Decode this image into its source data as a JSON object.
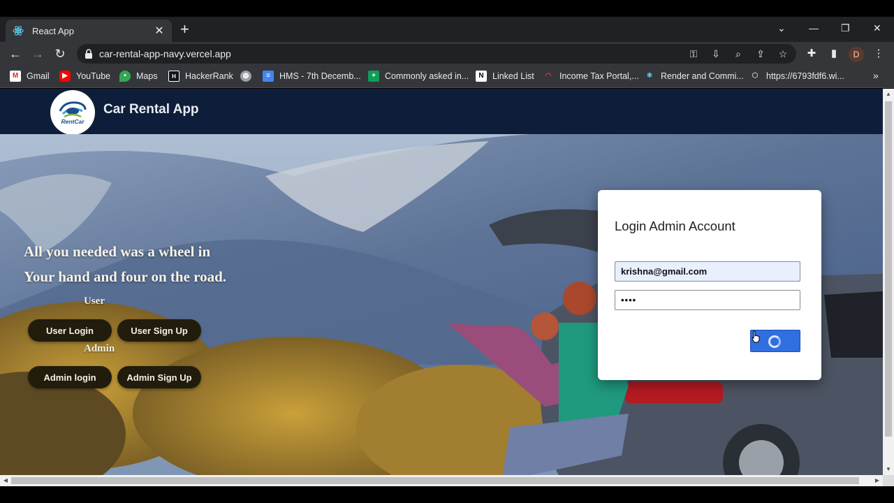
{
  "browser": {
    "tab_title": "React App",
    "url": "car-rental-app-navy.vercel.app",
    "profile_initial": "D",
    "bookmarks": [
      {
        "label": "Gmail",
        "icon": "gmail-icon"
      },
      {
        "label": "YouTube",
        "icon": "youtube-icon"
      },
      {
        "label": "Maps",
        "icon": "maps-icon"
      },
      {
        "label": "HackerRank",
        "icon": "hackerrank-icon"
      },
      {
        "label": "",
        "icon": "globe-icon"
      },
      {
        "label": "HMS - 7th Decemb...",
        "icon": "docs-icon"
      },
      {
        "label": "Commonly asked in...",
        "icon": "sheets-icon"
      },
      {
        "label": "Linked List",
        "icon": "notion-icon"
      },
      {
        "label": "Income Tax Portal,...",
        "icon": "incometax-icon"
      },
      {
        "label": "Render and Commi...",
        "icon": "react-icon"
      },
      {
        "label": "https://6793fdf6.wi...",
        "icon": "cube-icon"
      }
    ]
  },
  "app": {
    "title": "Car Rental App",
    "logo_text": "RentCar"
  },
  "hero": {
    "tagline_line1": "All you needed was a wheel in",
    "tagline_line2": "Your hand and four on the road.",
    "user_label": "User",
    "admin_label": "Admin",
    "user_login": "User Login",
    "user_signup": "User Sign Up",
    "admin_login": "Admin login",
    "admin_signup": "Admin Sign Up"
  },
  "login": {
    "title": "Login Admin Account",
    "email_value": "krishna@gmail.com",
    "password_value": "••••"
  },
  "colors": {
    "header_bg": "#0e1d3a",
    "button_dark": "#211c0b",
    "submit_blue": "#2f6fe0"
  }
}
